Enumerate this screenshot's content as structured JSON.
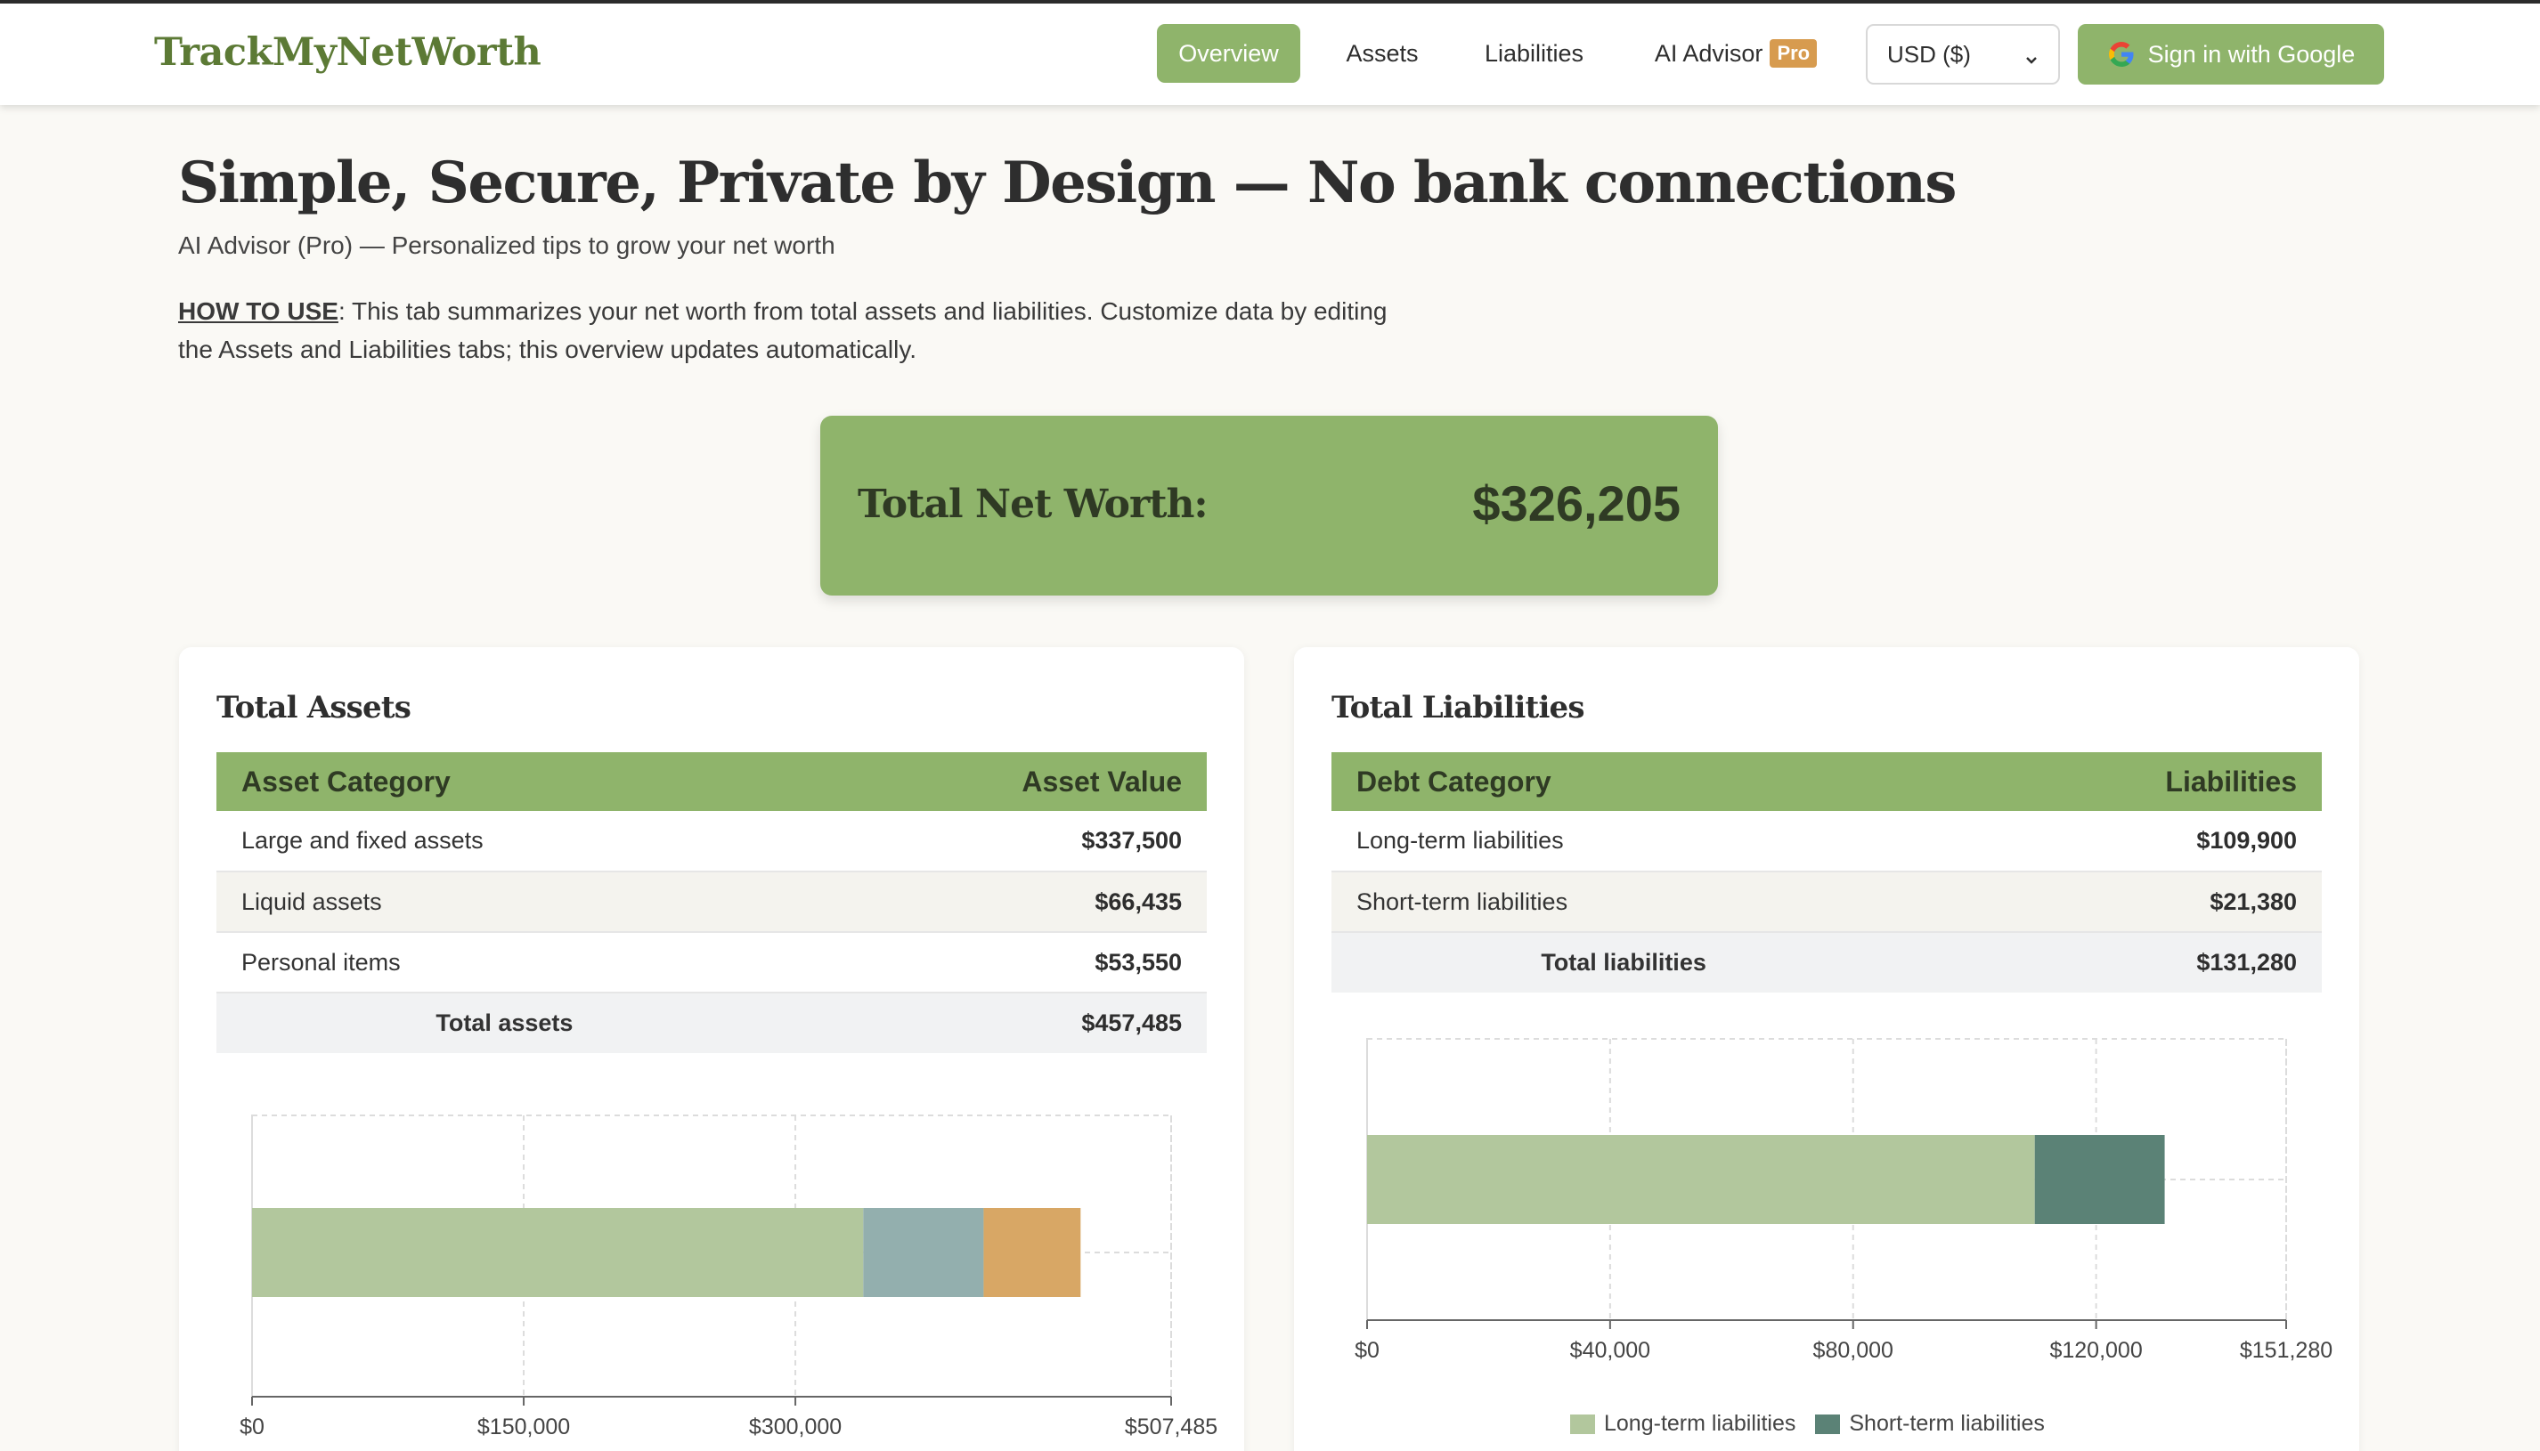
{
  "brand": "TrackMyNetWorth",
  "nav": {
    "overview": "Overview",
    "assets": "Assets",
    "liabilities": "Liabilities",
    "advisor": "AI Advisor",
    "pro_badge": "Pro"
  },
  "currency": {
    "selected": "USD ($)"
  },
  "signin": {
    "label": "Sign in with Google",
    "icon": "google-icon"
  },
  "hero": {
    "title": "Simple, Secure, Private by Design — No bank connections",
    "subtitle": "AI Advisor (Pro) — Personalized tips to grow your net worth",
    "howto_label": "HOW TO USE",
    "howto_text": ": This tab summarizes your net worth from total assets and liabilities. Customize data by editing the Assets and Liabilities tabs; this overview updates automatically."
  },
  "networth": {
    "label": "Total Net Worth:",
    "value": "$326,205"
  },
  "assets": {
    "title": "Total Assets",
    "col_category": "Asset Category",
    "col_value": "Asset Value",
    "rows": [
      {
        "category": "Large and fixed assets",
        "value": "$337,500"
      },
      {
        "category": "Liquid assets",
        "value": "$66,435"
      },
      {
        "category": "Personal items",
        "value": "$53,550"
      }
    ],
    "total_label": "Total assets",
    "total_value": "$457,485"
  },
  "liabilities": {
    "title": "Total Liabilities",
    "col_category": "Debt Category",
    "col_value": "Liabilities",
    "rows": [
      {
        "category": "Long-term liabilities",
        "value": "$109,900"
      },
      {
        "category": "Short-term liabilities",
        "value": "$21,380"
      }
    ],
    "total_label": "Total liabilities",
    "total_value": "$131,280"
  },
  "colors": {
    "accent": "#8fb46b",
    "brand_text": "#5c7a35",
    "pro_badge": "#d79b4f"
  },
  "chart_data": [
    {
      "type": "bar",
      "orientation": "horizontal",
      "stacked": true,
      "categories": [
        ""
      ],
      "series": [
        {
          "name": "Large and fixed assets",
          "values": [
            337500
          ],
          "color": "#b2c79d"
        },
        {
          "name": "Liquid assets",
          "values": [
            66435
          ],
          "color": "#93afae"
        },
        {
          "name": "Personal items",
          "values": [
            53550
          ],
          "color": "#d8a765"
        }
      ],
      "xlim": [
        0,
        507485
      ],
      "xticks": [
        0,
        150000,
        300000,
        507485
      ],
      "xtick_labels": [
        "$0",
        "$150,000",
        "$300,000",
        "$507,485"
      ],
      "grid": true,
      "legend": "none"
    },
    {
      "type": "bar",
      "orientation": "horizontal",
      "stacked": true,
      "categories": [
        ""
      ],
      "series": [
        {
          "name": "Long-term liabilities",
          "values": [
            109900
          ],
          "color": "#b2c79d"
        },
        {
          "name": "Short-term liabilities",
          "values": [
            21380
          ],
          "color": "#5b8276"
        }
      ],
      "xlim": [
        0,
        151280
      ],
      "xticks": [
        0,
        40000,
        80000,
        120000,
        151280
      ],
      "xtick_labels": [
        "$0",
        "$40,000",
        "$80,000",
        "$120,000",
        "$151,280"
      ],
      "grid": true,
      "legend": "bottom"
    }
  ]
}
